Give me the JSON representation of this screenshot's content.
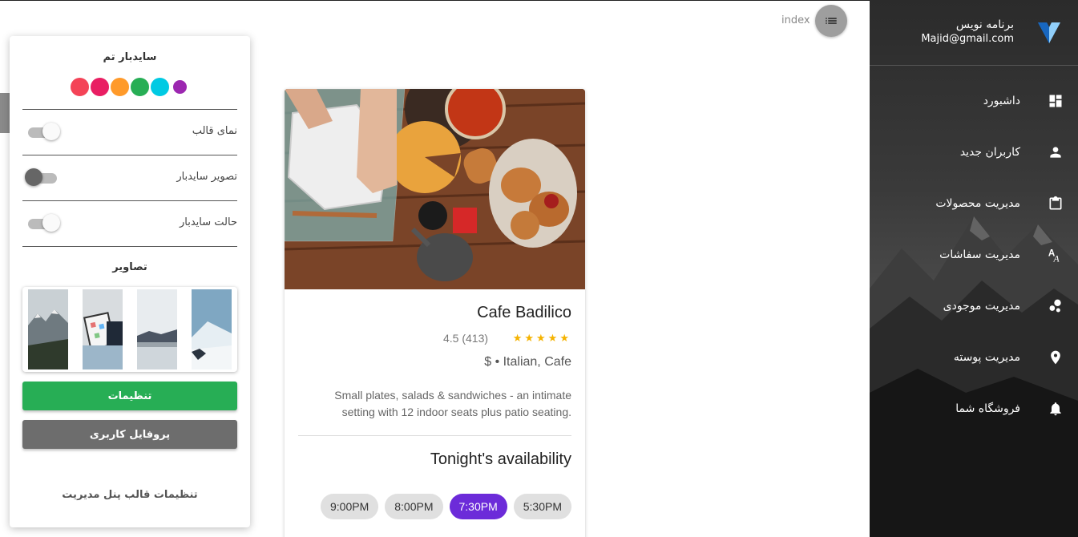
{
  "colors": {
    "accent_purple": "#6c2bd9",
    "green": "#27ae55",
    "gray_button": "#6d6d6d",
    "star": "#f5b301"
  },
  "sidebar": {
    "user_name": "برنامه نویس",
    "user_email": "Majid@gmail.com",
    "logo_icon": "vuetify-logo-icon",
    "items": [
      {
        "label": "داشبورد",
        "icon": "dashboard-icon"
      },
      {
        "label": "کاربران جدید",
        "icon": "person-icon"
      },
      {
        "label": "مدیریت محصولات",
        "icon": "clipboard-icon"
      },
      {
        "label": "مدیریت سفاشات",
        "icon": "translate-icon"
      },
      {
        "label": "مدیریت موجودی",
        "icon": "bubble-chart-icon"
      },
      {
        "label": "مدیریت پوسته",
        "icon": "location-icon"
      },
      {
        "label": "فروشگاه شما",
        "icon": "bell-icon"
      }
    ]
  },
  "header": {
    "breadcrumb": "index",
    "menu_icon": "list-icon"
  },
  "theme_panel": {
    "title": "سایدبار تم",
    "swatches": [
      "#f44357",
      "#e91e63",
      "#ff9a2a",
      "#27ae55",
      "#00cae3",
      "#9c27b0"
    ],
    "toggles": [
      {
        "label": "نمای قالب",
        "state": "on"
      },
      {
        "label": "تصویر سایدبار",
        "state": "off"
      },
      {
        "label": "حالت سایدبار",
        "state": "on"
      }
    ],
    "images_title": "تصاویر",
    "settings_button": "تنظیمات",
    "profile_button": "پروفایل کاربری",
    "footer": "تنظیمات قالب پنل مدیریت"
  },
  "card": {
    "title": "Cafe Badilico",
    "rating_value": 4.5,
    "rating_text": "4.5 (413)",
    "stars": "★★★★★",
    "category": "$ • Italian, Cafe",
    "description": "Small plates, salads & sandwiches - an intimate setting with 12 indoor seats plus patio seating.",
    "availability_title": "Tonight's availability",
    "times": [
      "5:30PM",
      "7:30PM",
      "8:00PM",
      "9:00PM"
    ],
    "selected_time": "7:30PM"
  }
}
